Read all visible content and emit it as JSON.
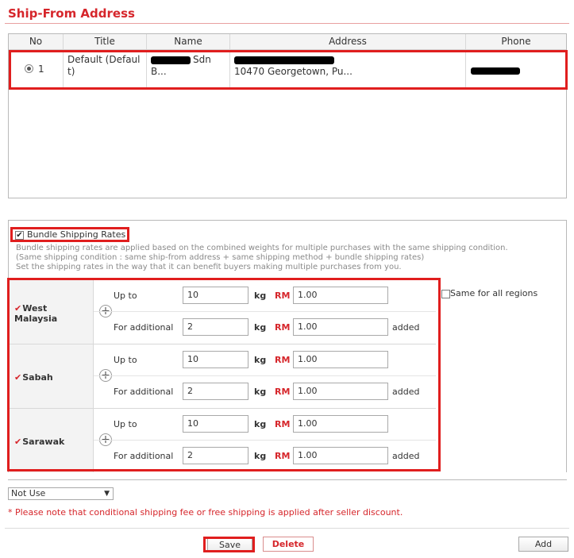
{
  "page_title": "Ship-From Address",
  "address_table": {
    "headers": [
      "No",
      "Title",
      "Name",
      "Address",
      "Phone"
    ],
    "rows": [
      {
        "no": "1",
        "title_line1": "Default (Defaul",
        "title_line2": "t)",
        "name_suffix": "Sdn",
        "name_line2": "B...",
        "address_line2": "10470 Georgetown, Pu..."
      }
    ]
  },
  "bundle": {
    "label": "Bundle Shipping Rates",
    "checked": true,
    "notes": [
      "Bundle shipping rates are applied based on the combined weights for multiple purchases with the same shipping condition.",
      "(Same shipping condition : same ship-from address + same shipping method + bundle shipping rates)",
      "Set the shipping rates in the way that it can benefit buyers making multiple purchases from you."
    ]
  },
  "rates_labels": {
    "up_to": "Up to",
    "for_additional": "For additional",
    "kg": "kg",
    "currency": "RM",
    "added": "added",
    "tick": "✔"
  },
  "regions": [
    {
      "name_line1": "West",
      "name_line2": "Malaysia",
      "up_to_kg": "10",
      "up_to_rm": "1.00",
      "additional_kg": "2",
      "additional_rm": "1.00"
    },
    {
      "name_line1": "Sabah",
      "name_line2": "",
      "up_to_kg": "10",
      "up_to_rm": "1.00",
      "additional_kg": "2",
      "additional_rm": "1.00"
    },
    {
      "name_line1": "Sarawak",
      "name_line2": "",
      "up_to_kg": "10",
      "up_to_rm": "1.00",
      "additional_kg": "2",
      "additional_rm": "1.00"
    }
  ],
  "same_for_all_regions": "Same for all regions",
  "condition_select": "Not Use",
  "notice": "* Please note that conditional shipping fee or free shipping is applied after seller discount.",
  "buttons": {
    "save": "Save",
    "delete": "Delete",
    "add": "Add"
  },
  "colors": {
    "accent": "#d6262b",
    "highlight": "#e01e1e"
  }
}
